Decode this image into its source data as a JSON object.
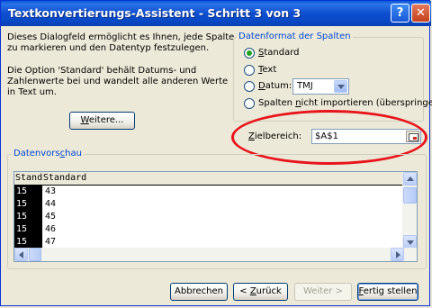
{
  "window": {
    "title": "Textkonvertierungs-Assistent - Schritt 3 von 3",
    "help_glyph": "?",
    "close_glyph": "✕"
  },
  "description": {
    "line1": "Dieses Dialogfeld ermöglicht es Ihnen, jede Spalte",
    "line2": "zu markieren und den Datentyp festzulegen.",
    "line3": "Die Option 'Standard' behält Datums- und",
    "line4": "Zahlenwerte bei und wandelt alle anderen Werte",
    "line5": "in Text um."
  },
  "weitere_button": {
    "label_u": "W",
    "label_rest": "eitere..."
  },
  "format_group": {
    "title": "Datenformat der Spalten",
    "options": [
      {
        "label_u": "S",
        "label_rest": "tandard",
        "selected": true
      },
      {
        "label_u": "T",
        "label_rest": "ext",
        "selected": false
      },
      {
        "label_u": "D",
        "label_rest": "atum:",
        "selected": false
      },
      {
        "label_before": "Spalten ",
        "label_u": "n",
        "label_rest": "icht importieren (überspringen)",
        "selected": false
      }
    ],
    "date_format": "TMJ"
  },
  "zielbereich": {
    "label_u": "Z",
    "label_rest": "ielbereich:",
    "value": "$A$1"
  },
  "preview": {
    "title_before": "Datenvors",
    "title_u": "c",
    "title_rest": "hau",
    "headers": [
      "Standard",
      "Standard"
    ],
    "rows": [
      [
        "15",
        "43"
      ],
      [
        "15",
        "44"
      ],
      [
        "15",
        "45"
      ],
      [
        "15",
        "46"
      ],
      [
        "15",
        "47"
      ]
    ]
  },
  "footer": {
    "abbrechen": "Abbrechen",
    "zurueck_before": "< ",
    "zurueck_u": "Z",
    "zurueck_rest": "urück",
    "weiter": "Weiter >",
    "fertig_u": "F",
    "fertig_rest": "ertig stellen"
  },
  "colors": {
    "annotation_ellipse": "#e8141b",
    "title_bar": "#0a4fd0",
    "group_title": "#0046d5"
  }
}
